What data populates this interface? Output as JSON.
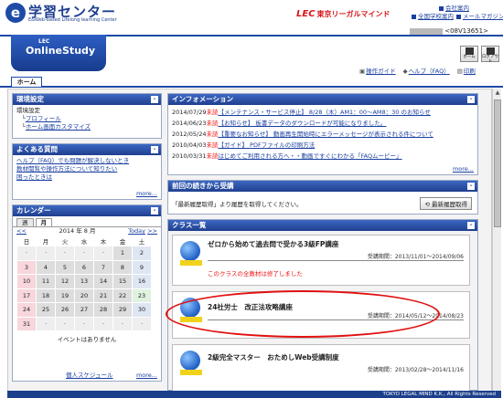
{
  "header": {
    "logo_text": "学習センター",
    "logo_sub": "E&Web-based Lifelong learning Center",
    "lec_brand": "東京リーガルマインド",
    "company_link": "会社案内",
    "school_link": "全国学校案内",
    "mail_link": "メールマガジン",
    "user_id": "<08V13651>",
    "brand_tab_top": "LEC",
    "brand_tab_name": "OnlineStudy",
    "home_btn": "ホーム",
    "logout_btn": "ログアウト",
    "help_links": [
      "操作ガイド",
      "ヘルプ（FAQ）",
      "印刷"
    ],
    "home_tab": "ホーム"
  },
  "env_panel": {
    "title": "環境設定",
    "section_label": "環境設定",
    "items": [
      "プロフィール",
      "ホーム画面カスタマイズ"
    ]
  },
  "faq_panel": {
    "title": "よくある質問",
    "items": [
      "ヘルプ（FAQ）でも問題が解決しないとき",
      "教材閲覧や操作方法について知りたい",
      "困ったときは"
    ],
    "more": "more..."
  },
  "calendar": {
    "title": "カレンダー",
    "tabs": [
      "週",
      "月"
    ],
    "prev": "<<",
    "month_label": "2014 年 8 月",
    "today": "Today",
    "next": ">>",
    "weekdays": [
      "日",
      "月",
      "火",
      "水",
      "木",
      "金",
      "土"
    ],
    "rows": [
      [
        "",
        "",
        "",
        "",
        "",
        "1",
        "2"
      ],
      [
        "3",
        "4",
        "5",
        "6",
        "7",
        "8",
        "9"
      ],
      [
        "10",
        "11",
        "12",
        "13",
        "14",
        "15",
        "16"
      ],
      [
        "17",
        "18",
        "19",
        "20",
        "21",
        "22",
        "23"
      ],
      [
        "24",
        "25",
        "26",
        "27",
        "28",
        "29",
        "30"
      ],
      [
        "31",
        "",
        "",
        "",
        "",
        "",
        ""
      ]
    ],
    "today_day": "23",
    "no_events": "イベントはありません",
    "personal_schedule": "個人スケジュール",
    "more": "more..."
  },
  "info_panel": {
    "title": "インフォメーション",
    "items": [
      {
        "date": "2014/07/29",
        "unread": "未読",
        "text": "【メンテナンス・サービス停止】 8/28（木）AM1：00～AM8：30 のお知らせ"
      },
      {
        "date": "2014/06/23",
        "unread": "未読",
        "text": "【お知らせ】 板書データのダウンロードが可能になりました。"
      },
      {
        "date": "2012/05/24",
        "unread": "未読",
        "text": "【重要なお知らせ】 動画再生開始時にエラーメッセージが表示される件について"
      },
      {
        "date": "2010/04/03",
        "unread": "未読",
        "text": "【ガイド】 PDFファイルの印刷方法"
      },
      {
        "date": "2010/03/31",
        "unread": "未読",
        "text": "はじめてご利用される方へ・・動画ですぐにわかる「FAQムービー」"
      }
    ],
    "more": "more..."
  },
  "resume_panel": {
    "title": "前回の続きから受講",
    "message": "「最新履歴取得」より履歴を取得してください。",
    "button": "最新履歴取得"
  },
  "class_panel": {
    "title": "クラス一覧",
    "courses": [
      {
        "title": "ゼロから始めて過去問で受かる3級FP講座",
        "period": "受講期間：2013/11/01～2014/09/06",
        "note": "このクラスの全教材は修了しました"
      },
      {
        "title": "24社労士　改正法攻略講座",
        "period": "受講期間：2014/05/12～2014/08/23",
        "note": ""
      },
      {
        "title": "2級完全マスター　おためしWeb受講制度",
        "period": "受講期間：2013/02/28～2014/11/16",
        "note": ""
      }
    ]
  },
  "footer": {
    "copyright": "TOKYO LEGAL MIND K.K., All Rights Reserved"
  }
}
